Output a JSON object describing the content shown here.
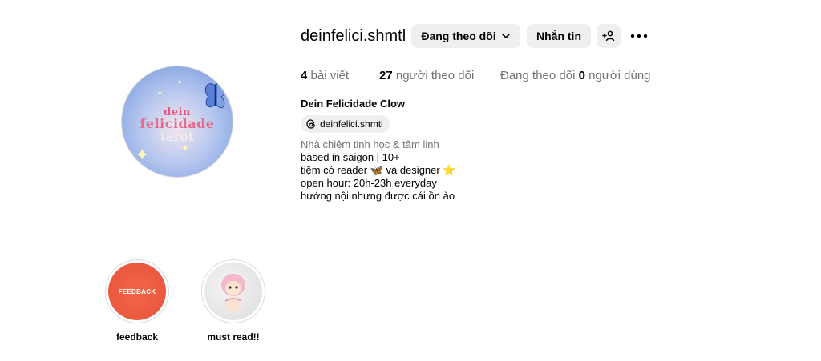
{
  "profile": {
    "username": "deinfelici.shmtl",
    "full_name": "Dein Felicidade Clow",
    "threads_handle": "deinfelici.shmtl",
    "category": "Nhà chiêm tinh học & tâm linh",
    "avatar_logo": [
      "dein",
      "felicidade",
      "tarot"
    ],
    "bio_lines": [
      "based in saigon | 10+",
      "tiệm có reader 🦋 và designer ⭐",
      "open hour: 20h-23h everyday",
      "hướng nội nhưng được cái ồn ào"
    ]
  },
  "actions": {
    "following_label": "Đang theo dõi",
    "message_label": "Nhắn tin",
    "add_user_icon": "add-user-icon",
    "more_icon": "more-horizontal-icon"
  },
  "stats": {
    "posts_count": "4",
    "posts_label": "bài viết",
    "followers_count": "27",
    "followers_label": "người theo dõi",
    "following_prefix": "Đang theo dõi",
    "following_count": "0",
    "following_suffix": "người dùng"
  },
  "highlights": [
    {
      "label": "feedback",
      "cover_text": "FEEDBACK"
    },
    {
      "label": "must read!!"
    }
  ],
  "colors": {
    "button_bg": "#efefef",
    "muted_text": "#737373",
    "highlight_feedback": "#e8523a"
  }
}
